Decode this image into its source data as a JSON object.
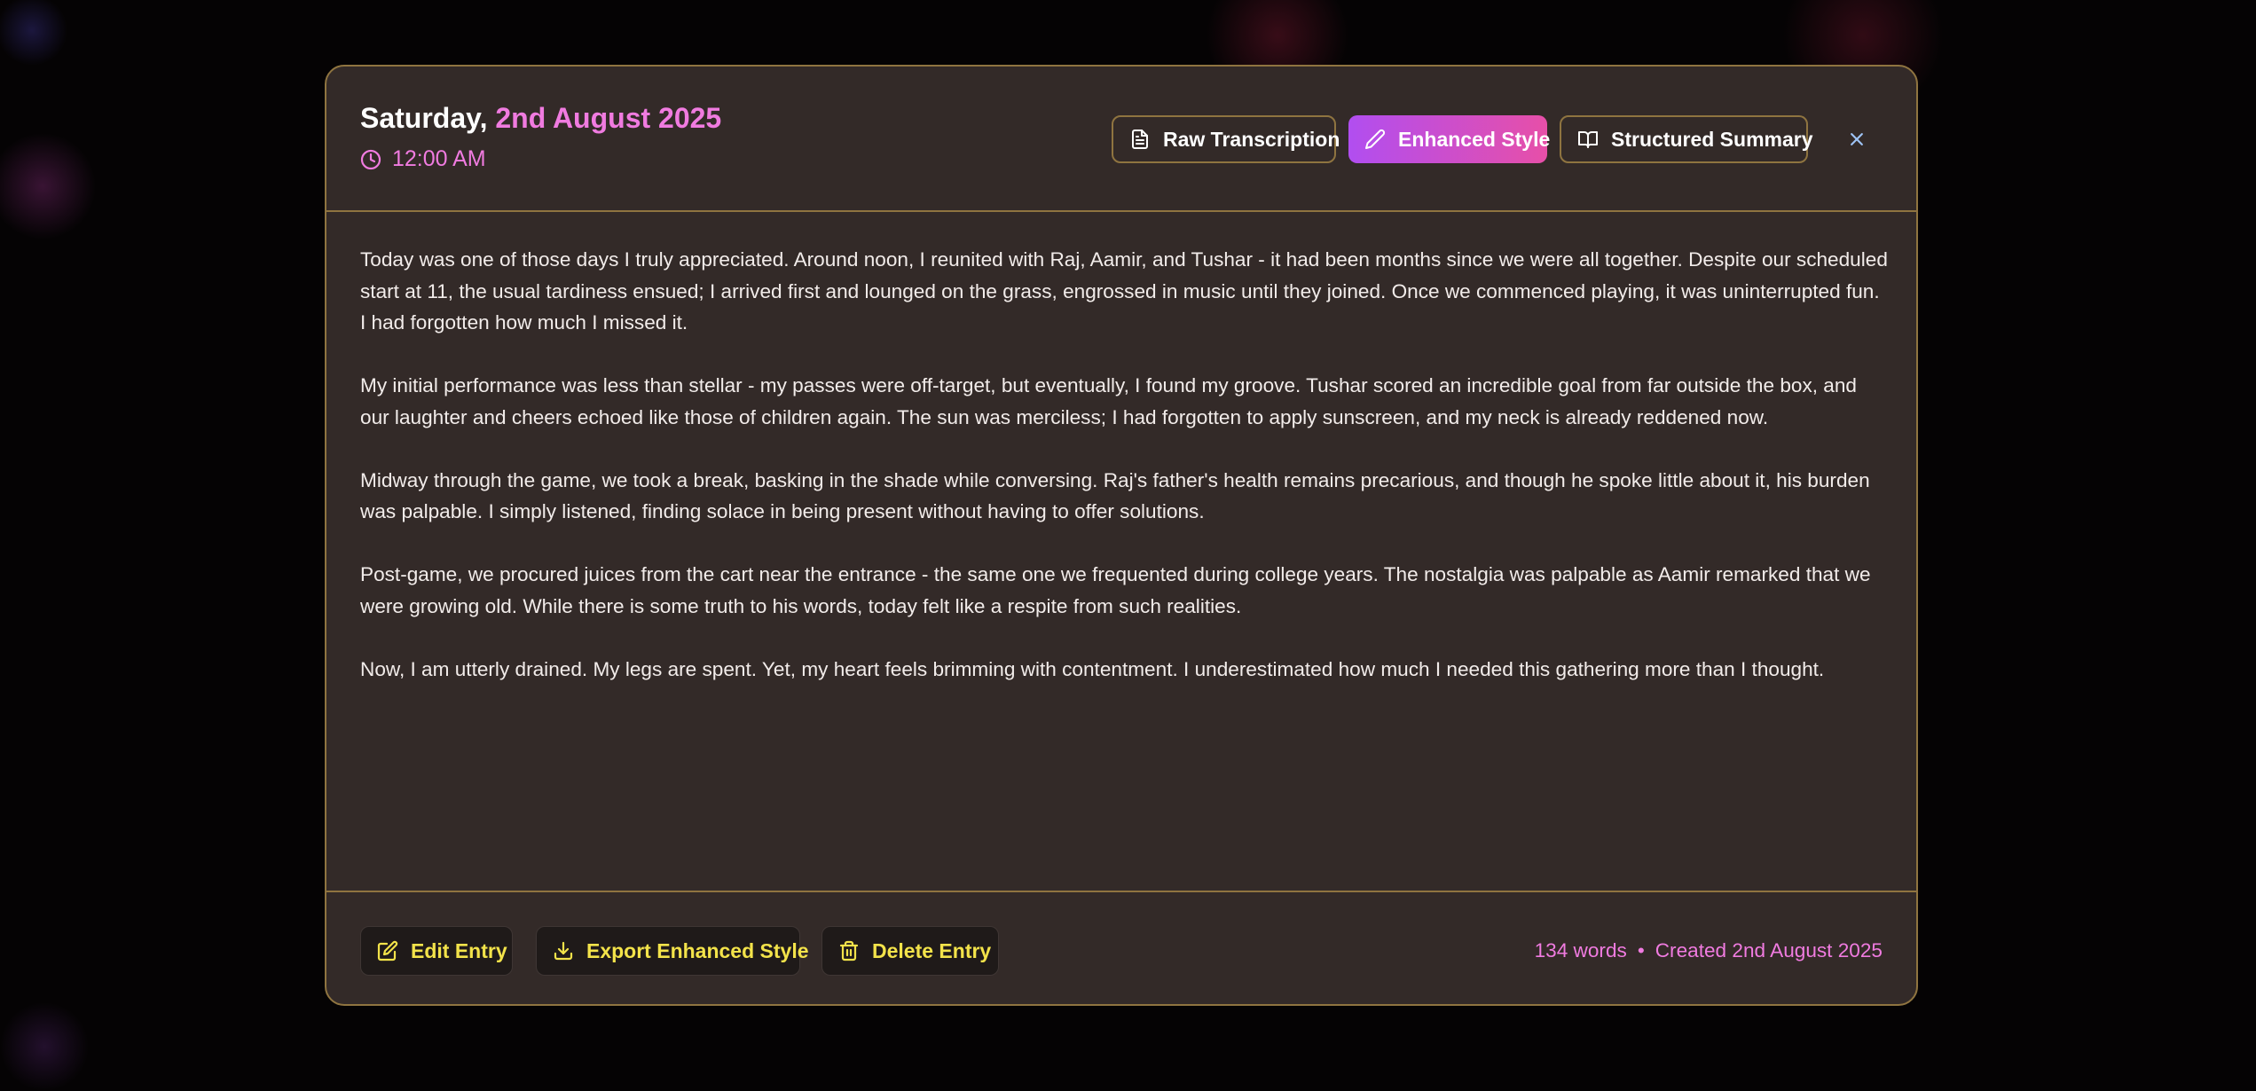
{
  "colors": {
    "accent_pink": "#f07be0",
    "border_gold": "#8f7440",
    "modal_bg": "#332a28",
    "action_yellow": "#f3e34a",
    "enhanced_gradient_start": "#b14ef0",
    "enhanced_gradient_end": "#e74fa8"
  },
  "entry": {
    "weekday": "Saturday,",
    "date": "2nd August 2025",
    "time": "12:00 AM",
    "clock_icon": "clock-icon"
  },
  "tabs": [
    {
      "label": "Raw Transcription",
      "icon": "document-icon",
      "active": false
    },
    {
      "label": "Enhanced Style",
      "icon": "pencil-icon",
      "active": true
    },
    {
      "label": "Structured Summary",
      "icon": "book-icon",
      "active": false
    }
  ],
  "close_icon": "close-icon",
  "paragraphs": [
    "Today was one of those days I truly appreciated. Around noon, I reunited with Raj, Aamir, and Tushar - it had been months since we were all together. Despite our scheduled start at 11, the usual tardiness ensued; I arrived first and lounged on the grass, engrossed in music until they joined. Once we commenced playing, it was uninterrupted fun. I had forgotten how much I missed it.",
    "My initial performance was less than stellar - my passes were off-target, but eventually, I found my groove. Tushar scored an incredible goal from far outside the box, and our laughter and cheers echoed like those of children again. The sun was merciless; I had forgotten to apply sunscreen, and my neck is already reddened now.",
    "Midway through the game, we took a break, basking in the shade while conversing. Raj's father's health remains precarious, and though he spoke little about it, his burden was palpable. I simply listened, finding solace in being present without having to offer solutions.",
    "Post-game, we procured juices from the cart near the entrance - the same one we frequented during college years. The nostalgia was palpable as Aamir remarked that we were growing old. While there is some truth to his words, today felt like a respite from such realities.",
    "Now, I am utterly drained. My legs are spent. Yet, my heart feels brimming with contentment. I underestimated how much I needed this gathering more than I thought."
  ],
  "footer": {
    "edit_label": "Edit Entry",
    "export_label": "Export Enhanced Style",
    "delete_label": "Delete Entry",
    "word_count": "134 words",
    "separator": "•",
    "created": "Created 2nd August 2025"
  }
}
